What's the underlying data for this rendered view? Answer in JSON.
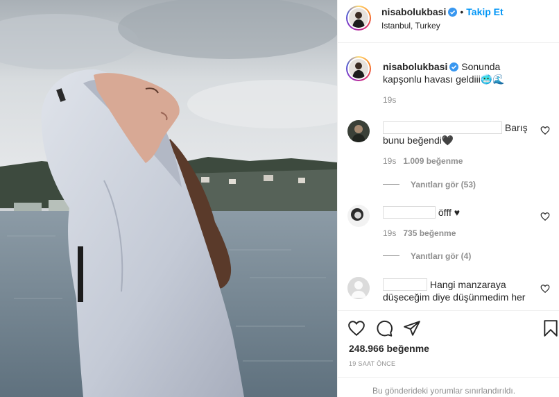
{
  "post": {
    "username": "nisabolukbasi",
    "follow_label": "Takip Et",
    "separator": "•",
    "location": "Istanbul, Turkey",
    "caption": "Sonunda kapşonlu havası geldiii🥶🌊",
    "caption_time": "19s",
    "likes": "248.966 beğenme",
    "timestamp": "19 SAAT ÖNCE",
    "restricted_note": "Bu gönderideki yorumlar sınırlandırıldı."
  },
  "comments": [
    {
      "text": "Barış bunu beğendi🖤",
      "time": "19s",
      "likes": "1.009 beğenme",
      "replies": "Yanıtları gör (53)"
    },
    {
      "text": "öfff ♥",
      "time": "19s",
      "likes": "735 beğenme",
      "replies": "Yanıtları gör (4)"
    },
    {
      "text": "Hangi manzaraya düşeceğim diye düşünmedim her",
      "time": "",
      "likes": "",
      "replies": ""
    }
  ],
  "icons": {
    "verified": "verified-badge-icon",
    "like": "heart-icon",
    "comment": "comment-bubble-icon",
    "share": "paper-plane-icon",
    "save": "bookmark-icon"
  },
  "colors": {
    "link_blue": "#0095f6",
    "verified_blue": "#3897f0",
    "text": "#262626",
    "muted": "#8e8e8e"
  }
}
